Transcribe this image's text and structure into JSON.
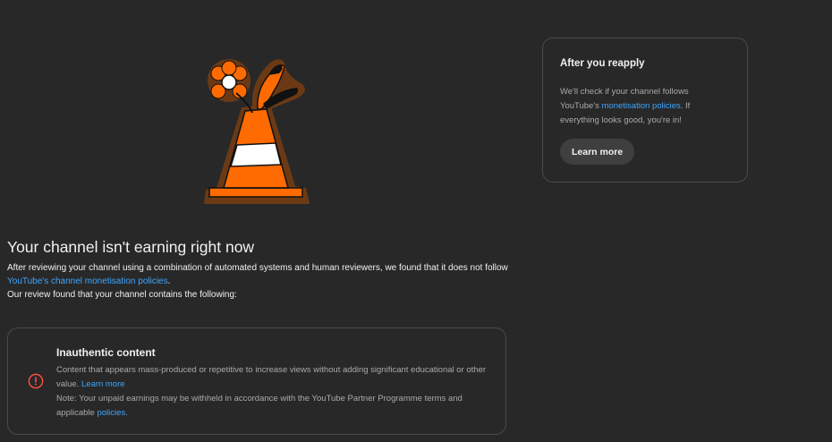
{
  "illustration": {
    "name": "traffic-cone-with-flower",
    "colors": {
      "orange": "#ff6b00",
      "outline": "#6b3a15",
      "white": "#ffffff",
      "black": "#111111"
    }
  },
  "status": {
    "headline": "Your channel isn't earning right now",
    "description_part1": "After reviewing your channel using a combination of automated systems and human reviewers, we found that it does not follow",
    "policy_link": "YouTube's channel monetisation policies",
    "description_period": ".",
    "review_intro": "Our review found that your channel contains the following:"
  },
  "issue": {
    "icon": "alert-circle-icon",
    "icon_color": "#ff4e45",
    "title": "Inauthentic content",
    "body": "Content that appears mass-produced or repetitive to increase views without adding significant educational or other value.",
    "learn_more": "Learn more",
    "note": "Note: Your unpaid earnings may be withheld in accordance with the YouTube Partner Programme terms and applicable",
    "policies_link": "policies",
    "period": "."
  },
  "reapply": {
    "title": "After you reapply",
    "body_part1": "We'll check if your channel follows YouTube's",
    "link": "monetisation policies",
    "body_part2": ". If everything looks good, you're in!",
    "button": "Learn more"
  },
  "theme": {
    "background": "#282828",
    "link": "#3ea6ff",
    "border": "#4a4a4a"
  }
}
